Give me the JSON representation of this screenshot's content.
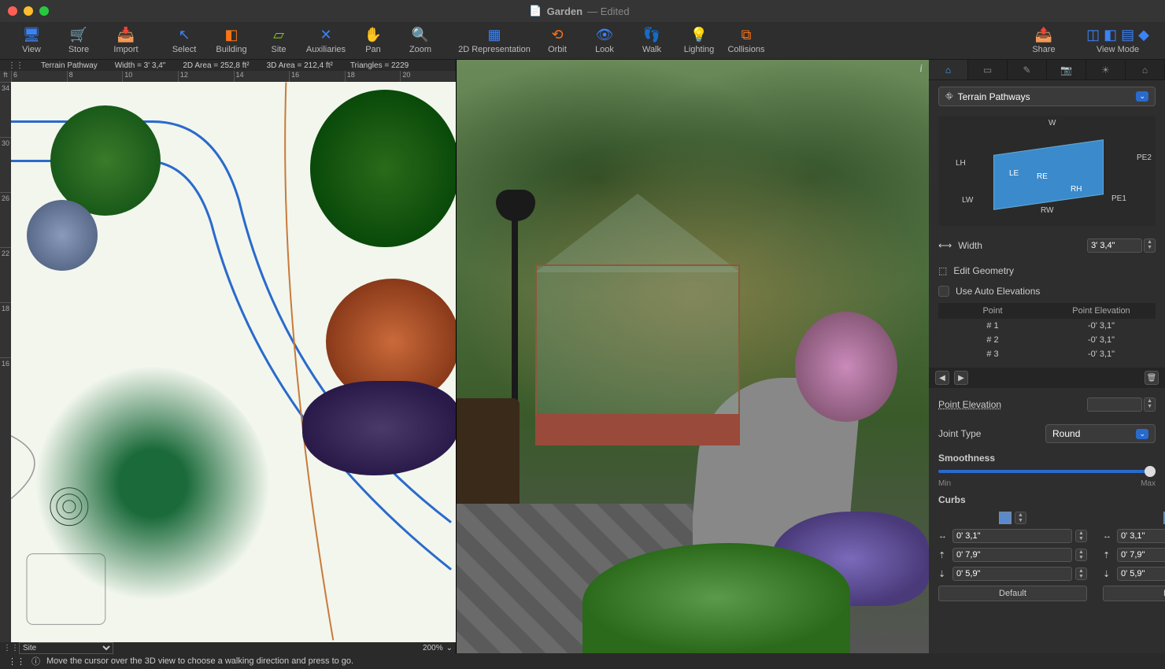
{
  "window": {
    "title": "Garden",
    "status": "— Edited"
  },
  "toolbar": [
    {
      "id": "view",
      "label": "View",
      "icon": "🖥",
      "color": "#3b82f6"
    },
    {
      "id": "store",
      "label": "Store",
      "icon": "🛒",
      "color": "#22c55e"
    },
    {
      "id": "import",
      "label": "Import",
      "icon": "📥",
      "color": "#3b82f6"
    },
    {
      "sep": true
    },
    {
      "id": "select",
      "label": "Select",
      "icon": "↖",
      "color": "#3b82f6"
    },
    {
      "id": "building",
      "label": "Building",
      "icon": "◧",
      "color": "#f97316"
    },
    {
      "id": "site",
      "label": "Site",
      "icon": "▱",
      "color": "#84cc16"
    },
    {
      "id": "auxiliaries",
      "label": "Auxiliaries",
      "icon": "✕",
      "color": "#3b82f6"
    },
    {
      "id": "pan",
      "label": "Pan",
      "icon": "✋",
      "color": "#3b82f6"
    },
    {
      "id": "zoom",
      "label": "Zoom",
      "icon": "🔍",
      "color": "#22c55e"
    },
    {
      "sep": true
    },
    {
      "id": "2drep",
      "label": "2D Representation",
      "icon": "▦",
      "color": "#3b82f6",
      "wide": true
    },
    {
      "id": "orbit",
      "label": "Orbit",
      "icon": "⟲",
      "color": "#f97316"
    },
    {
      "id": "look",
      "label": "Look",
      "icon": "👁",
      "color": "#3b82f6"
    },
    {
      "id": "walk",
      "label": "Walk",
      "icon": "👣",
      "color": "#22c55e"
    },
    {
      "id": "lighting",
      "label": "Lighting",
      "icon": "💡",
      "color": "#fbbf24"
    },
    {
      "id": "collisions",
      "label": "Collisions",
      "icon": "⧉",
      "color": "#f97316"
    },
    {
      "spacer": true
    },
    {
      "id": "share",
      "label": "Share",
      "icon": "📤",
      "color": "#22c55e"
    },
    {
      "sep": true
    },
    {
      "id": "viewmode",
      "label": "View Mode",
      "icon": "◫ ◧ ▤ ◆",
      "color": "#3b82f6",
      "wide": true
    }
  ],
  "infobar": {
    "selection": "Terrain Pathway",
    "width": "Width = 3' 3,4\"",
    "area2d": "2D Area = 252,8 ft²",
    "area3d": "3D Area = 212,4 ft²",
    "triangles": "Triangles = 2229"
  },
  "ruler_h": [
    "6",
    "8",
    "10",
    "12",
    "14",
    "16",
    "18",
    "20"
  ],
  "ruler_v": [
    "34",
    "30",
    "26",
    "22",
    "18",
    "16"
  ],
  "footer2d": {
    "label": "Site",
    "zoom": "200%"
  },
  "inspector": {
    "dropdown": "Terrain Pathways",
    "diagram": {
      "W": "W",
      "LH": "LH",
      "LE": "LE",
      "RE": "RE",
      "RH": "RH",
      "LW": "LW",
      "RW": "RW",
      "PE1": "PE1",
      "PE2": "PE2"
    },
    "width_label": "Width",
    "width_val": "3' 3,4\"",
    "edit_geom": "Edit Geometry",
    "use_auto": "Use Auto Elevations",
    "table_hdr": [
      "Point",
      "Point Elevation"
    ],
    "table_rows": [
      {
        "pt": "# 1",
        "el": "-0' 3,1\""
      },
      {
        "pt": "# 2",
        "el": "-0' 3,1\""
      },
      {
        "pt": "# 3",
        "el": "-0' 3,1\""
      }
    ],
    "pe_label": "Point Elevation",
    "pe_val": "",
    "jt_label": "Joint Type",
    "jt_val": "Round",
    "smooth_label": "Smoothness",
    "smooth_min": "Min",
    "smooth_max": "Max",
    "curbs_label": "Curbs",
    "curb_left": {
      "a": "0' 3,1\"",
      "b": "0' 7,9\"",
      "c": "0' 5,9\""
    },
    "curb_right": {
      "a": "0' 3,1\"",
      "b": "0' 7,9\"",
      "c": "0' 5,9\""
    },
    "default": "Default"
  },
  "statusbar": {
    "msg": "Move the cursor over the 3D view to choose a walking direction and press to go."
  }
}
